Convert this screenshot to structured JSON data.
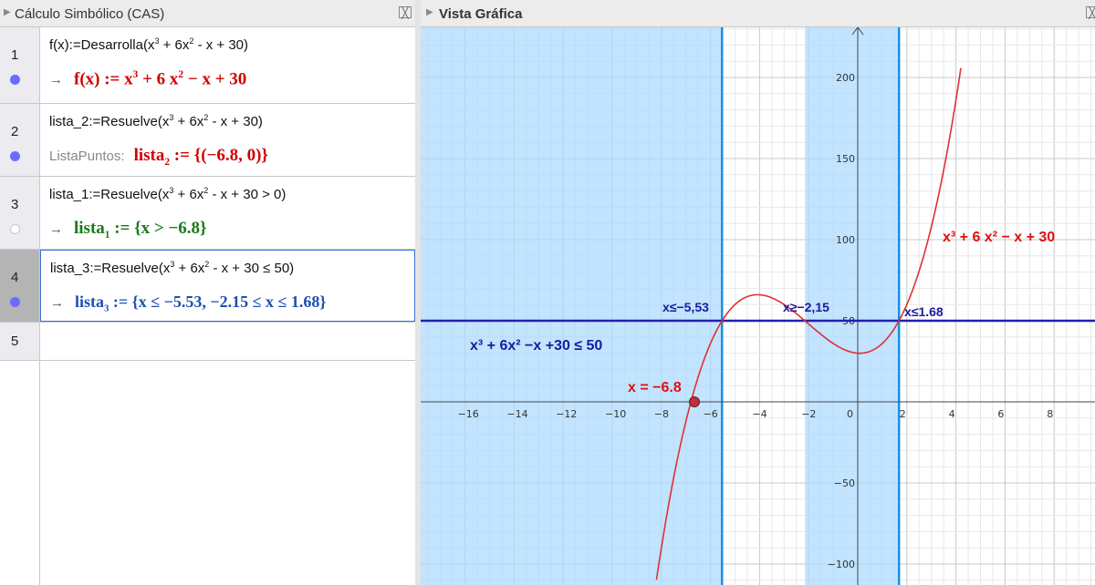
{
  "cas": {
    "title": "Cálculo Simbólico (CAS)",
    "close_glyph": "╳",
    "rows": [
      {
        "num": "1",
        "input_pre": "f(x):=Desarrolla(x",
        "input_e1": "3",
        "input_mid": " + 6x",
        "input_e2": "2",
        "input_post": " - x + 30)",
        "out_lhs": "f(x) := x",
        "out_e1": "3",
        "out_mid": " + 6 x",
        "out_e2": "2",
        "out_post": " − x + 30",
        "color": "#d00000"
      },
      {
        "num": "2",
        "input_pre": "lista_2:=Resuelve(x",
        "input_e1": "3",
        "input_mid": " + 6x",
        "input_e2": "2",
        "input_post": " - x + 30)",
        "prefix": "ListaPuntos:",
        "out_name": "lista",
        "out_sub": "2",
        "out_rest": " := {(−6.8, 0)}",
        "color": "#d00000"
      },
      {
        "num": "3",
        "input_pre": "lista_1:=Resuelve(x",
        "input_e1": "3",
        "input_mid": " + 6x",
        "input_e2": "2",
        "input_post": " - x + 30 > 0)",
        "out_name": "lista",
        "out_sub": "1",
        "out_rest": " := {x > −6.8}",
        "color": "#1a7a1a"
      },
      {
        "num": "4",
        "input_pre": "lista_3:=Resuelve(x",
        "input_e1": "3",
        "input_mid": " + 6x",
        "input_e2": "2",
        "input_post": " - x + 30 ≤ 50)",
        "out_name": "lista",
        "out_sub": "3",
        "out_rest": " := {x ≤ −5.53, −2.15 ≤ x ≤ 1.68}",
        "color": "#1d4fb0"
      },
      {
        "num": "5"
      }
    ],
    "arrow": "→"
  },
  "graphics": {
    "title": "Vista Gráfica",
    "x_ticks": [
      "−16",
      "−14",
      "−12",
      "−10",
      "−8",
      "−6",
      "−4",
      "−2",
      "0",
      "2",
      "4",
      "6",
      "8"
    ],
    "y_ticks": [
      "200",
      "150",
      "100",
      "50",
      "−50",
      "−100"
    ],
    "labels": {
      "func": "x³ + 6 x² − x + 30",
      "ineq": "x³ + 6x² −x +30 ≤ 50",
      "root": "x = −6.8",
      "b1": "x≤−5,53",
      "b2": "x≥−2,15",
      "b3": "x≤1.68"
    },
    "colors": {
      "curve": "#e03030",
      "line": "#2020b0",
      "shade": "#a8d8ff",
      "bound": "#1c8fe0",
      "label_blue": "#1a1aa0",
      "label_red": "#e01010"
    }
  }
}
